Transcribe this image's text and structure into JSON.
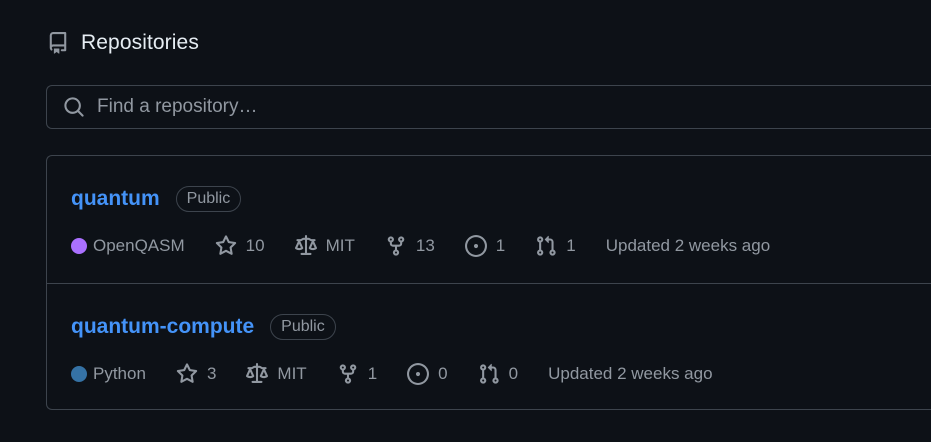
{
  "header": {
    "title": "Repositories",
    "icon": "repo-icon"
  },
  "search": {
    "placeholder": "Find a repository…",
    "value": "",
    "icon": "search-icon"
  },
  "repos": [
    {
      "name": "quantum",
      "visibility": "Public",
      "language": "OpenQASM",
      "language_color": "#AA70FF",
      "stars": "10",
      "license": "MIT",
      "forks": "13",
      "issues": "1",
      "pull_requests": "1",
      "updated": "Updated 2 weeks ago"
    },
    {
      "name": "quantum-compute",
      "visibility": "Public",
      "language": "Python",
      "language_color": "#3572A5",
      "stars": "3",
      "license": "MIT",
      "forks": "1",
      "issues": "0",
      "pull_requests": "0",
      "updated": "Updated 2 weeks ago"
    }
  ],
  "colors": {
    "background": "#0d1117",
    "border": "#3d444d",
    "link": "#4493f8",
    "muted": "#9198a1",
    "text": "#e6edf3"
  }
}
